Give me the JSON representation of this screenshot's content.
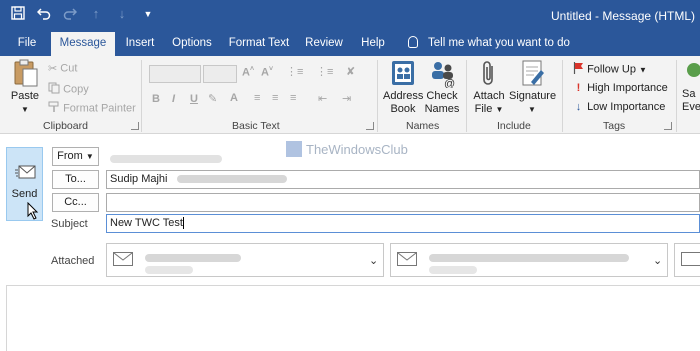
{
  "window": {
    "title": "Untitled  -  Message (HTML)"
  },
  "qat": {
    "icons": [
      "save-icon",
      "undo-icon",
      "redo-icon",
      "up-arrow-icon",
      "down-arrow-icon",
      "customize-icon"
    ]
  },
  "tabs": [
    {
      "label": "File",
      "active": false
    },
    {
      "label": "Message",
      "active": true
    },
    {
      "label": "Insert",
      "active": false
    },
    {
      "label": "Options",
      "active": false
    },
    {
      "label": "Format Text",
      "active": false
    },
    {
      "label": "Review",
      "active": false
    },
    {
      "label": "Help",
      "active": false
    }
  ],
  "tellme": {
    "label": "Tell me what you want to do",
    "icon": "lightbulb-icon"
  },
  "ribbon": {
    "clipboard": {
      "label": "Clipboard",
      "paste": "Paste",
      "cut": "Cut",
      "copy": "Copy",
      "format_painter": "Format Painter"
    },
    "basic_text": {
      "label": "Basic Text",
      "bold": "B",
      "italic": "I",
      "underline": "U"
    },
    "names": {
      "label": "Names",
      "address_book": [
        "Address",
        "Book"
      ],
      "check_names": [
        "Check",
        "Names"
      ]
    },
    "include": {
      "label": "Include",
      "attach_file": [
        "Attach",
        "File"
      ],
      "signature": "Signature"
    },
    "tags": {
      "label": "Tags",
      "follow_up": "Follow Up",
      "high_importance": "High Importance",
      "low_importance": "Low Importance"
    },
    "partial": {
      "line1": "Sa",
      "line2": "Eve"
    }
  },
  "compose": {
    "send_label": "Send",
    "from_label": "From",
    "to_label": "To...",
    "cc_label": "Cc...",
    "subject_label": "Subject",
    "attached_label": "Attached",
    "to_value": "Sudip Majhi",
    "subject_value": "New TWC Test"
  },
  "watermark": {
    "text": "TheWindowsClub"
  },
  "colors": {
    "accent": "#2b579a",
    "ribbon_bg": "#f3f3f3",
    "send_bg": "#cce4f7"
  }
}
